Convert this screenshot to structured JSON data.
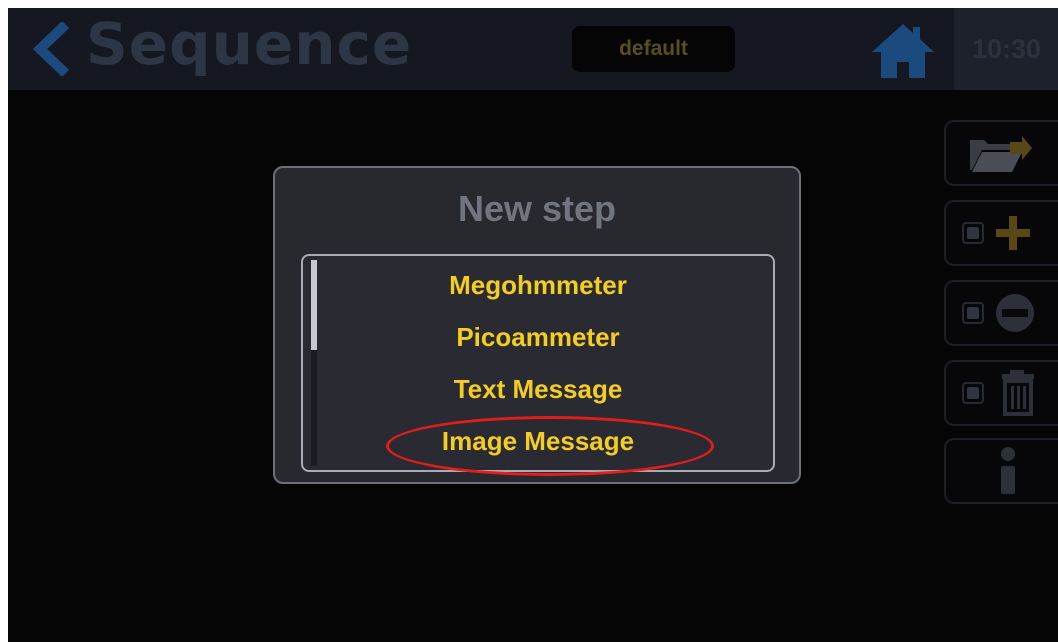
{
  "header": {
    "title": "Sequence",
    "profile_label": "default",
    "clock": "10:30"
  },
  "dialog": {
    "title": "New step",
    "options": [
      {
        "label": "Megohmmeter"
      },
      {
        "label": "Picoammeter"
      },
      {
        "label": "Text Message"
      },
      {
        "label": "Image Message"
      }
    ]
  },
  "colors": {
    "accent_yellow": "#f4cd22",
    "highlight_red": "#e31c1c",
    "header_bg": "#151821",
    "modal_bg": "#28292f"
  },
  "icons": {
    "back": "chevron-left",
    "home": "home",
    "open_folder": "folder-open-arrow",
    "add": "plus",
    "remove": "minus-circle",
    "delete": "trash",
    "info": "info"
  }
}
